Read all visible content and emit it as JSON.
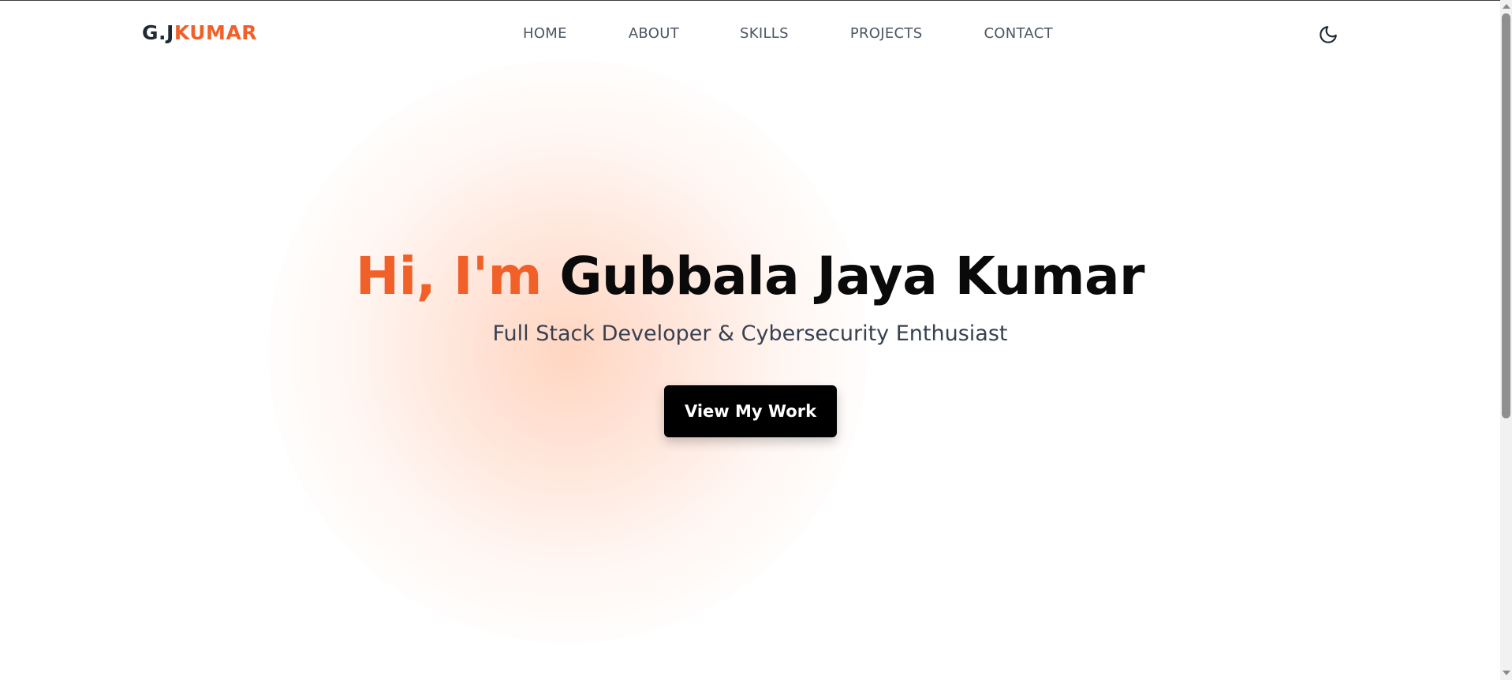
{
  "nav": {
    "logo": {
      "prefix": "G.J",
      "accent": "KUMAR"
    },
    "links": [
      "HOME",
      "ABOUT",
      "SKILLS",
      "PROJECTS",
      "CONTACT"
    ],
    "theme_toggle_icon": "moon-icon"
  },
  "hero": {
    "greeting": "Hi, I'm",
    "name": "Gubbala Jaya Kumar",
    "subtitle": "Full Stack Developer & Cybersecurity Enthusiast",
    "cta_label": "View My Work"
  },
  "colors": {
    "accent": "#f2602a",
    "text_dark": "#0a0a0a",
    "text_muted": "#4b5563",
    "button_bg": "#000000",
    "glow": "#ffceb6"
  }
}
